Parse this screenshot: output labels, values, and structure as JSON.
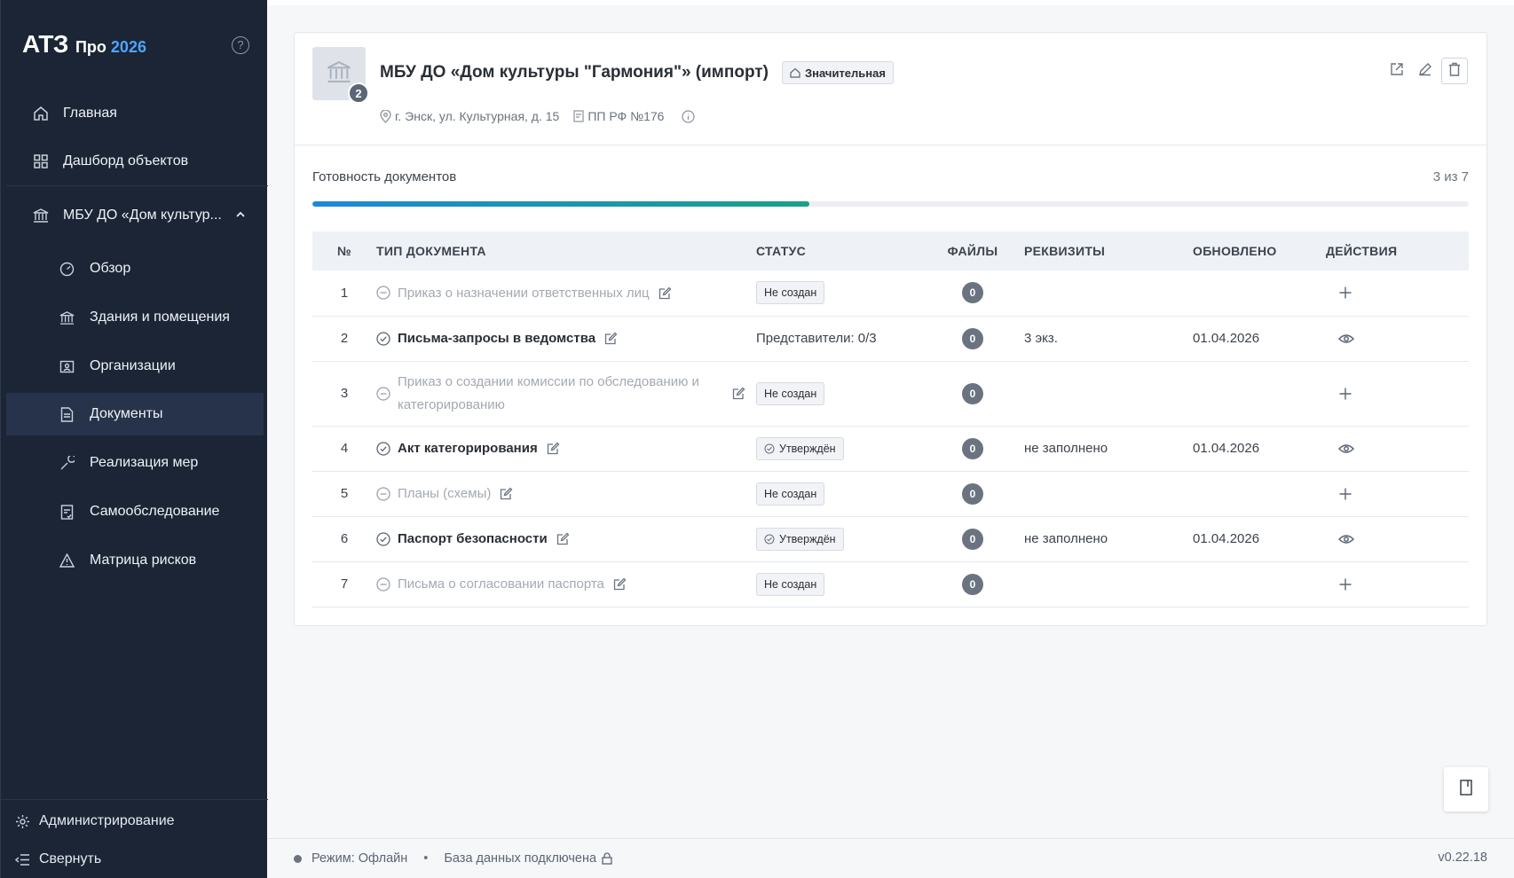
{
  "app": {
    "logo": "АТЗ",
    "edition": "Про",
    "year": "2026",
    "help_icon": "question-circle-icon"
  },
  "sidebar": {
    "items": [
      {
        "label": "Главная",
        "icon": "home-icon"
      },
      {
        "label": "Дашборд объектов",
        "icon": "grid-icon"
      },
      {
        "label": "МБУ ДО «Дом культур...",
        "icon": "building-columns-icon",
        "expanded": true
      },
      {
        "label": "Обзор",
        "icon": "gauge-icon"
      },
      {
        "label": "Здания и помещения",
        "icon": "building-columns-icon"
      },
      {
        "label": "Организации",
        "icon": "id-card-icon"
      },
      {
        "label": "Документы",
        "icon": "document-icon",
        "active": true
      },
      {
        "label": "Реализация мер",
        "icon": "wrench-icon"
      },
      {
        "label": "Самообследование",
        "icon": "checklist-icon"
      },
      {
        "label": "Матрица рисков",
        "icon": "warning-icon"
      }
    ],
    "admin_label": "Администрирование",
    "collapse_label": "Свернуть"
  },
  "object": {
    "title": "МБУ ДО «Дом культуры \"Гармония\"» (импорт)",
    "buildings_count": "2",
    "category": "Значительная",
    "address": "г. Энск, ул. Культурная, д. 15",
    "regulation": "ПП РФ №176"
  },
  "readiness": {
    "label": "Готовность документов",
    "count": "3 из 7",
    "progress": 0.43
  },
  "table": {
    "headers": {
      "num": "№",
      "type": "ТИП ДОКУМЕНТА",
      "status": "СТАТУС",
      "files": "ФАЙЛЫ",
      "requisites": "РЕКВИЗИТЫ",
      "updated": "ОБНОВЛЕНО",
      "actions": "ДЕЙСТВИЯ"
    },
    "rows": [
      {
        "num": "1",
        "type": "Приказ о назначении ответственных лиц",
        "state": "none",
        "status": "Не создан",
        "files": "0",
        "requisites": "",
        "updated": "",
        "action": "plus-icon"
      },
      {
        "num": "2",
        "type": "Письма-запросы в ведомства",
        "state": "done",
        "status": "Представители: 0/3",
        "files": "0",
        "requisites": "3 экз.",
        "updated": "01.04.2026",
        "action": "eye-icon"
      },
      {
        "num": "3",
        "type": "Приказ о создании комиссии по обследованию и категорированию",
        "state": "none",
        "status": "Не создан",
        "files": "0",
        "requisites": "",
        "updated": "",
        "action": "plus-icon"
      },
      {
        "num": "4",
        "type": "Акт категорирования",
        "state": "done",
        "status": "Утверждён",
        "files": "0",
        "requisites": "не заполнено",
        "updated": "01.04.2026",
        "action": "eye-icon"
      },
      {
        "num": "5",
        "type": "Планы (схемы)",
        "state": "none",
        "status": "Не создан",
        "files": "0",
        "requisites": "",
        "updated": "",
        "action": "plus-icon"
      },
      {
        "num": "6",
        "type": "Паспорт безопасности",
        "state": "done",
        "status": "Утверждён",
        "files": "0",
        "requisites": "не заполнено",
        "updated": "01.04.2026",
        "action": "eye-icon"
      },
      {
        "num": "7",
        "type": "Письма о согласовании паспорта",
        "state": "none",
        "status": "Не создан",
        "files": "0",
        "requisites": "",
        "updated": "",
        "action": "plus-icon"
      }
    ]
  },
  "footer": {
    "mode": "Режим: Офлайн",
    "db": "База данных подключена",
    "version": "v0.22.18"
  },
  "colors": {
    "sidebar_bg": "#1b2535",
    "accent": "#4ea4ff",
    "progress_start": "#1e88d8",
    "progress_end": "#1aa189"
  }
}
